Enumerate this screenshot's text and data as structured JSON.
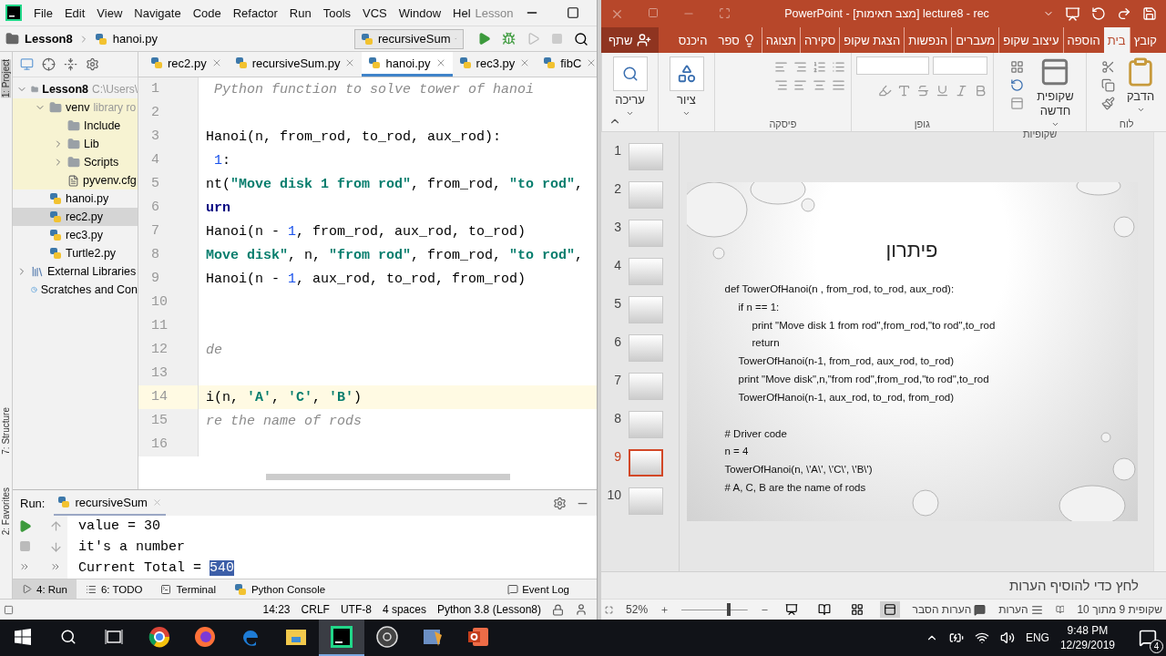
{
  "pycharm": {
    "menu": [
      "File",
      "Edit",
      "View",
      "Navigate",
      "Code",
      "Refactor",
      "Run",
      "Tools",
      "VCS",
      "Window",
      "Hel"
    ],
    "title": "Lesson",
    "breadcrumb": [
      "Lesson8",
      "hanoi.py"
    ],
    "run_config": "recursiveSum",
    "side_tabs": {
      "project": "1: Project",
      "structure": "7: Structure",
      "favorites": "2: Favorites"
    },
    "tree": [
      {
        "label": "Lesson8",
        "hint": "C:\\Users\\",
        "kind": "folder",
        "expanded": true,
        "selected": false,
        "excluded": false,
        "children": [
          {
            "label": "venv",
            "hint": "library ro",
            "kind": "folder",
            "expanded": true,
            "selected": false,
            "excluded": true,
            "children": [
              {
                "label": "Include",
                "kind": "folder",
                "selected": false
              },
              {
                "label": "Lib",
                "kind": "folder",
                "expanded": false,
                "selected": false
              },
              {
                "label": "Scripts",
                "kind": "folder",
                "expanded": false,
                "selected": false
              },
              {
                "label": "pyvenv.cfg",
                "kind": "file",
                "selected": false
              }
            ]
          },
          {
            "label": "hanoi.py",
            "kind": "python",
            "selected": false,
            "excluded": false
          },
          {
            "label": "rec2.py",
            "kind": "python",
            "selected": true,
            "excluded": false
          },
          {
            "label": "rec3.py",
            "kind": "python",
            "selected": false,
            "excluded": false
          },
          {
            "label": "Turtle2.py",
            "kind": "python",
            "selected": false,
            "excluded": false
          }
        ]
      },
      {
        "label": "External Libraries",
        "kind": "library",
        "expanded": false,
        "selected": false,
        "excluded": false
      },
      {
        "label": "Scratches and Con",
        "kind": "scratch",
        "selected": false,
        "excluded": false
      }
    ],
    "editor_tabs": [
      {
        "label": "rec2.py",
        "selected": false
      },
      {
        "label": "recursiveSum.py",
        "selected": false
      },
      {
        "label": "hanoi.py",
        "selected": true
      },
      {
        "label": "rec3.py",
        "selected": false
      },
      {
        "label": "fibC",
        "selected": false
      }
    ],
    "code_lines": [
      {
        "number": "1",
        "current": false,
        "tokens": [
          {
            "kind": "comment",
            "text": " Python function to solve tower of hanoi"
          }
        ]
      },
      {
        "number": "2",
        "current": false
      },
      {
        "number": "3",
        "current": false,
        "tokens": [
          {
            "kind": "plain",
            "text": "Hanoi(n, from_rod, to_rod, aux_rod):"
          }
        ]
      },
      {
        "number": "4",
        "current": false,
        "tokens": [
          {
            "kind": "number",
            "text": " 1"
          },
          {
            "kind": "plain",
            "text": ":"
          }
        ]
      },
      {
        "number": "5",
        "current": false,
        "tokens": [
          {
            "kind": "plain",
            "text": "nt("
          },
          {
            "kind": "string",
            "text": "\"Move disk 1 from rod\""
          },
          {
            "kind": "plain",
            "text": ", from_rod, "
          },
          {
            "kind": "string",
            "text": "\"to rod\""
          },
          {
            "kind": "plain",
            "text": ","
          }
        ]
      },
      {
        "number": "6",
        "current": false,
        "tokens": [
          {
            "kind": "keyword",
            "text": "urn"
          }
        ]
      },
      {
        "number": "7",
        "current": false,
        "tokens": [
          {
            "kind": "plain",
            "text": "Hanoi(n - "
          },
          {
            "kind": "number",
            "text": "1"
          },
          {
            "kind": "plain",
            "text": ", from_rod, aux_rod, to_rod)"
          }
        ]
      },
      {
        "number": "8",
        "current": false,
        "tokens": [
          {
            "kind": "string",
            "text": "Move disk\""
          },
          {
            "kind": "plain",
            "text": ", n, "
          },
          {
            "kind": "string",
            "text": "\"from rod\""
          },
          {
            "kind": "plain",
            "text": ", from_rod, "
          },
          {
            "kind": "string",
            "text": "\"to rod\""
          },
          {
            "kind": "plain",
            "text": ","
          }
        ]
      },
      {
        "number": "9",
        "current": false,
        "tokens": [
          {
            "kind": "plain",
            "text": "Hanoi(n - "
          },
          {
            "kind": "number",
            "text": "1"
          },
          {
            "kind": "plain",
            "text": ", aux_rod, to_rod, from_rod)"
          }
        ]
      },
      {
        "number": "10",
        "current": false
      },
      {
        "number": "11",
        "current": false
      },
      {
        "number": "12",
        "current": false,
        "tokens": [
          {
            "kind": "comment",
            "text": "de"
          }
        ]
      },
      {
        "number": "13",
        "current": false
      },
      {
        "number": "14",
        "current": true,
        "tokens": [
          {
            "kind": "plain",
            "text": "i(n, "
          },
          {
            "kind": "string",
            "text": "'A'"
          },
          {
            "kind": "plain",
            "text": ", "
          },
          {
            "kind": "string",
            "text": "'C'"
          },
          {
            "kind": "plain",
            "text": ", "
          },
          {
            "kind": "string",
            "text": "'B'"
          },
          {
            "kind": "plain",
            "text": ")"
          }
        ]
      },
      {
        "number": "15",
        "current": false,
        "tokens": [
          {
            "kind": "comment",
            "text": "re the name of rods"
          }
        ]
      },
      {
        "number": "16",
        "current": false
      }
    ],
    "run": {
      "label": "Run:",
      "config": "recursiveSum",
      "output": [
        {
          "text": "value = 30"
        },
        {
          "text": "it's a number"
        },
        {
          "text": "Current Total = ",
          "selection": "540"
        }
      ]
    },
    "tool_tabs": [
      {
        "label": "4: Run",
        "kind": "run",
        "selected": true
      },
      {
        "label": "6: TODO",
        "kind": "todo",
        "selected": false
      },
      {
        "label": "Terminal",
        "kind": "terminal",
        "selected": false
      },
      {
        "label": "Python Console",
        "kind": "console",
        "selected": false
      }
    ],
    "event_log": "Event Log",
    "status": [
      "14:23",
      "CRLF",
      "UTF-8",
      "4 spaces",
      "Python 3.8 (Lesson8)"
    ]
  },
  "powerpoint": {
    "title": "PowerPoint - [מצב תאימות] lecture8 - rec",
    "ribbon_tabs": [
      {
        "label": "קובץ",
        "selected": false
      },
      {
        "label": "בית",
        "selected": true
      },
      {
        "label": "הוספה",
        "selected": false
      },
      {
        "label": "עיצוב שקופ",
        "selected": false
      },
      {
        "label": "מעברים",
        "selected": false
      },
      {
        "label": "הנפשות",
        "selected": false
      },
      {
        "label": "הצגת שקופ",
        "selected": false
      },
      {
        "label": "סקירה",
        "selected": false
      },
      {
        "label": "תצוגה",
        "selected": false
      }
    ],
    "tell_me": "ספר",
    "sign_in": "היכנס",
    "share": "שתף",
    "ribbon_groups": [
      {
        "kind": "clipboard",
        "label": "לוח",
        "button": "הדבק"
      },
      {
        "kind": "slides",
        "label": "שקופיות",
        "button": "שקופית חדשה"
      },
      {
        "kind": "font",
        "label": "גופן"
      },
      {
        "kind": "paragraph",
        "label": "פיסקה"
      },
      {
        "kind": "drawing",
        "button": "ציור"
      },
      {
        "kind": "editing",
        "button": "עריכה"
      }
    ],
    "thumbnails": [
      {
        "number": "1",
        "selected": false
      },
      {
        "number": "2",
        "selected": false
      },
      {
        "number": "3",
        "selected": false
      },
      {
        "number": "4",
        "selected": false
      },
      {
        "number": "5",
        "selected": false
      },
      {
        "number": "6",
        "selected": false
      },
      {
        "number": "7",
        "selected": false
      },
      {
        "number": "8",
        "selected": false
      },
      {
        "number": "9",
        "selected": true
      },
      {
        "number": "10",
        "selected": false
      }
    ],
    "slide": {
      "title": "פיתרון",
      "function_lines": [
        {
          "kind": "top",
          "text": "def TowerOfHanoi(n , from_rod, to_rod, aux_rod):"
        },
        {
          "kind": "block",
          "text": "if n == 1:"
        },
        {
          "kind": "nested",
          "text": "print \"Move disk 1 from rod\",from_rod,\"to rod\",to_rod"
        },
        {
          "kind": "nested",
          "text": "return"
        },
        {
          "kind": "block",
          "text": "TowerOfHanoi(n-1, from_rod, aux_rod, to_rod)"
        },
        {
          "kind": "block",
          "text": "print \"Move disk\",n,\"from rod\",from_rod,\"to rod\",to_rod"
        },
        {
          "kind": "block",
          "text": "TowerOfHanoi(n-1, aux_rod, to_rod, from_rod)"
        }
      ],
      "driver_lines": [
        {
          "text": "# Driver code"
        },
        {
          "text": "n = 4"
        },
        {
          "text": "TowerOfHanoi(n, \\'A\\', \\'C\\', \\'B\\')"
        },
        {
          "text": "# A, C, B are the name of rods"
        }
      ]
    },
    "notes_placeholder": "לחץ כדי להוסיף הערות",
    "status": {
      "slide_count": "שקופית 9 מתוך 10",
      "notes": "הערות",
      "comments": "הערות הסבר",
      "zoom": "52%",
      "zoom_level": {
        "level": 0.72
      }
    },
    "views": [
      {
        "kind": "normal",
        "selected": true
      },
      {
        "kind": "sorter",
        "selected": false
      },
      {
        "kind": "reading",
        "selected": false
      },
      {
        "kind": "show",
        "selected": false
      }
    ]
  },
  "taskbar": {
    "apps": [
      {
        "kind": "round",
        "selected": false
      },
      {
        "kind": "flame",
        "selected": false
      },
      {
        "kind": "edge",
        "selected": false
      },
      {
        "kind": "folder",
        "selected": false
      },
      {
        "kind": "ide",
        "selected": true
      },
      {
        "kind": "ring",
        "selected": false
      },
      {
        "kind": "media",
        "selected": false
      },
      {
        "kind": "slides",
        "selected": false
      }
    ],
    "language": "ENG",
    "time": "9:48 PM",
    "date": "12/29/2019",
    "notifications": "4"
  }
}
